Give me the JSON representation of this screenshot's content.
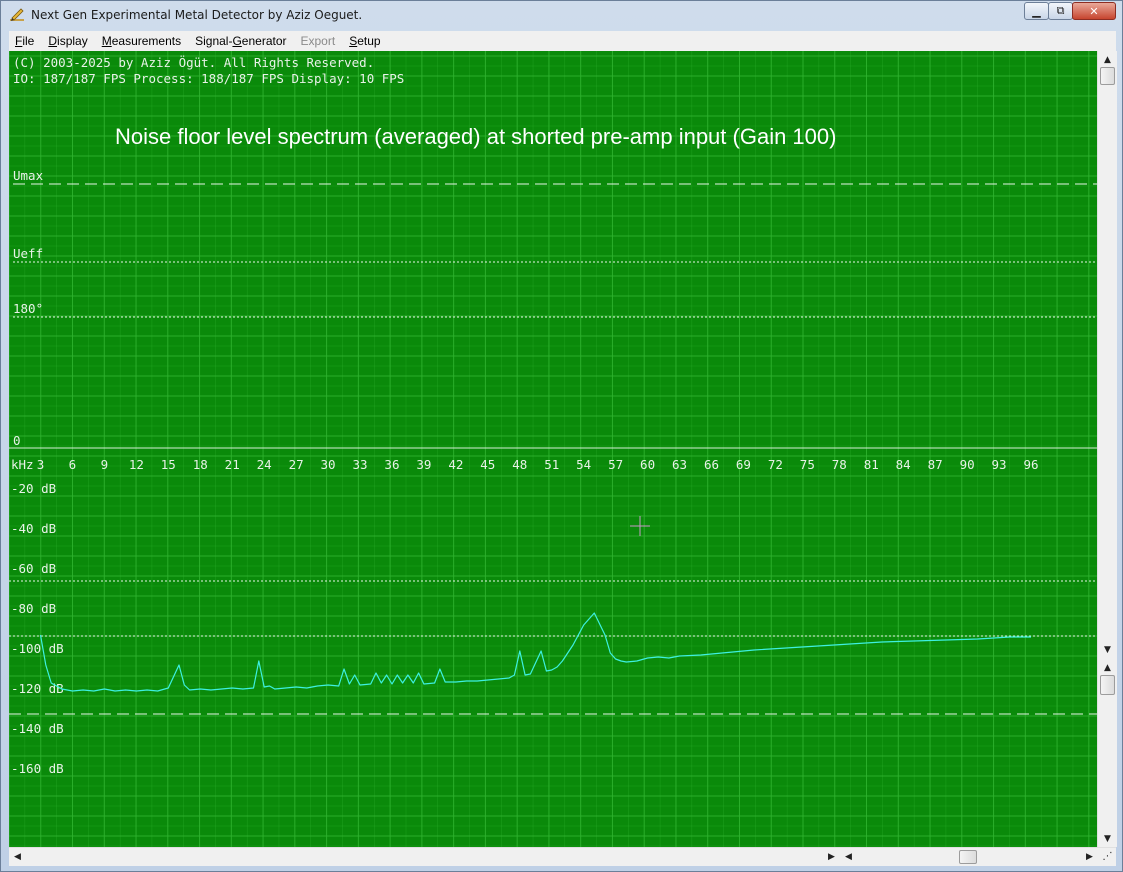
{
  "window": {
    "title": "Next Gen Experimental Metal Detector by Aziz Oeguet.",
    "icon": "pencil-icon",
    "controls": {
      "minimize": "minimize-icon",
      "maximize": "maximize-icon",
      "close": "close-icon"
    }
  },
  "menu": {
    "items": [
      {
        "label": "File",
        "accel": "F",
        "rest": "ile",
        "enabled": true
      },
      {
        "label": "Display",
        "accel": "D",
        "rest": "isplay",
        "enabled": true
      },
      {
        "label": "Measurements",
        "accel": "M",
        "rest": "easurements",
        "enabled": true
      },
      {
        "label": "Signal-Generator",
        "pre": "Signal-",
        "accel": "G",
        "rest": "enerator",
        "enabled": true
      },
      {
        "label": "Export",
        "accel": "",
        "rest": "Export",
        "enabled": false
      },
      {
        "label": "Setup",
        "accel": "S",
        "rest": "etup",
        "enabled": true
      }
    ]
  },
  "plot": {
    "background": "#0a8a0a",
    "grid_color": "#2fb32f",
    "trace_color": "#3df0e0",
    "copyright": "(C) 2003-2025 by Aziz Ögüt. All Rights Reserved.",
    "fps_line": "IO: 187/187 FPS  Process: 188/187 FPS  Display: 10 FPS",
    "annotation": "Noise floor level spectrum (averaged) at shorted pre-amp input (Gain 100)",
    "upper_labels": {
      "umax": "Umax",
      "ueff": "Ueff",
      "phase": "180°",
      "zero": "0"
    },
    "freq_unit": "kHz",
    "freq_ticks": [
      "3",
      "6",
      "9",
      "12",
      "15",
      "18",
      "21",
      "24",
      "27",
      "30",
      "33",
      "36",
      "39",
      "42",
      "45",
      "48",
      "51",
      "54",
      "57",
      "60",
      "63",
      "66",
      "69",
      "72",
      "75",
      "78",
      "81",
      "84",
      "87",
      "90",
      "93",
      "96"
    ],
    "db_labels": [
      "-20 dB",
      "-40 dB",
      "-60 dB",
      "-80 dB",
      "-100 dB",
      "-120 dB",
      "-140 dB",
      "-160 dB"
    ]
  },
  "chart_data": {
    "type": "line",
    "xlabel": "kHz",
    "ylabel": "dB",
    "xlim": [
      3,
      96
    ],
    "ylim": [
      -160,
      -20
    ],
    "grid": true,
    "series": [
      {
        "x": [
          3.0,
          3.5,
          4.0,
          5.0,
          6.0,
          7.0,
          8.0,
          9.0,
          10.0,
          11.0,
          12.0,
          13.0,
          14.0,
          15.0,
          16.0,
          16.5,
          17.0,
          18.0,
          19.0,
          20.0,
          21.0,
          22.0,
          23.0,
          23.5,
          24.0,
          24.5,
          25.0,
          26.0,
          27.0,
          28.0,
          29.0,
          30.0,
          31.0,
          31.5,
          32.0,
          32.5,
          33.0,
          34.0,
          34.5,
          35.0,
          35.5,
          36.0,
          36.5,
          37.0,
          37.5,
          38.0,
          38.5,
          39.0,
          40.0,
          40.5,
          41.0,
          42.0,
          43.0,
          44.0,
          45.0,
          46.0,
          47.0,
          47.5,
          48.0,
          48.5,
          49.0,
          50.0,
          50.5,
          51.0,
          51.5,
          52.0,
          53.0,
          54.0,
          55.0,
          56.0,
          56.5,
          57.0,
          57.5,
          58.0,
          59.0,
          60.0,
          61.0,
          62.0,
          63.0,
          65.0,
          67.0,
          70.0,
          73.0,
          76.0,
          79.0,
          82.0,
          85.0,
          88.0,
          91.0,
          94.0,
          96.0
        ],
        "y": [
          -93,
          -108,
          -117,
          -120,
          -121,
          -120.5,
          -121,
          -120,
          -121,
          -120.5,
          -121,
          -120.5,
          -121,
          -119.5,
          -108,
          -118,
          -120.5,
          -120,
          -120.5,
          -120,
          -119.5,
          -120,
          -119.5,
          -106,
          -119,
          -118.5,
          -120,
          -119.5,
          -119,
          -119.5,
          -118.5,
          -118,
          -118.5,
          -110,
          -117.5,
          -113,
          -118,
          -117.5,
          -112,
          -117,
          -113,
          -117.5,
          -113,
          -117,
          -113,
          -117,
          -112,
          -117.5,
          -117,
          -110,
          -116.5,
          -116.5,
          -116,
          -116,
          -115.5,
          -115,
          -114.5,
          -113,
          -101,
          -113,
          -112.5,
          -101,
          -111,
          -110.5,
          -109,
          -106,
          -98,
          -88,
          -82,
          -93,
          -102,
          -105,
          -106,
          -106.5,
          -106,
          -104.5,
          -104,
          -104.5,
          -103.5,
          -103,
          -102,
          -100.5,
          -99.5,
          -98.5,
          -97.5,
          -96.5,
          -96,
          -95.5,
          -95,
          -94,
          -94
        ]
      }
    ]
  }
}
